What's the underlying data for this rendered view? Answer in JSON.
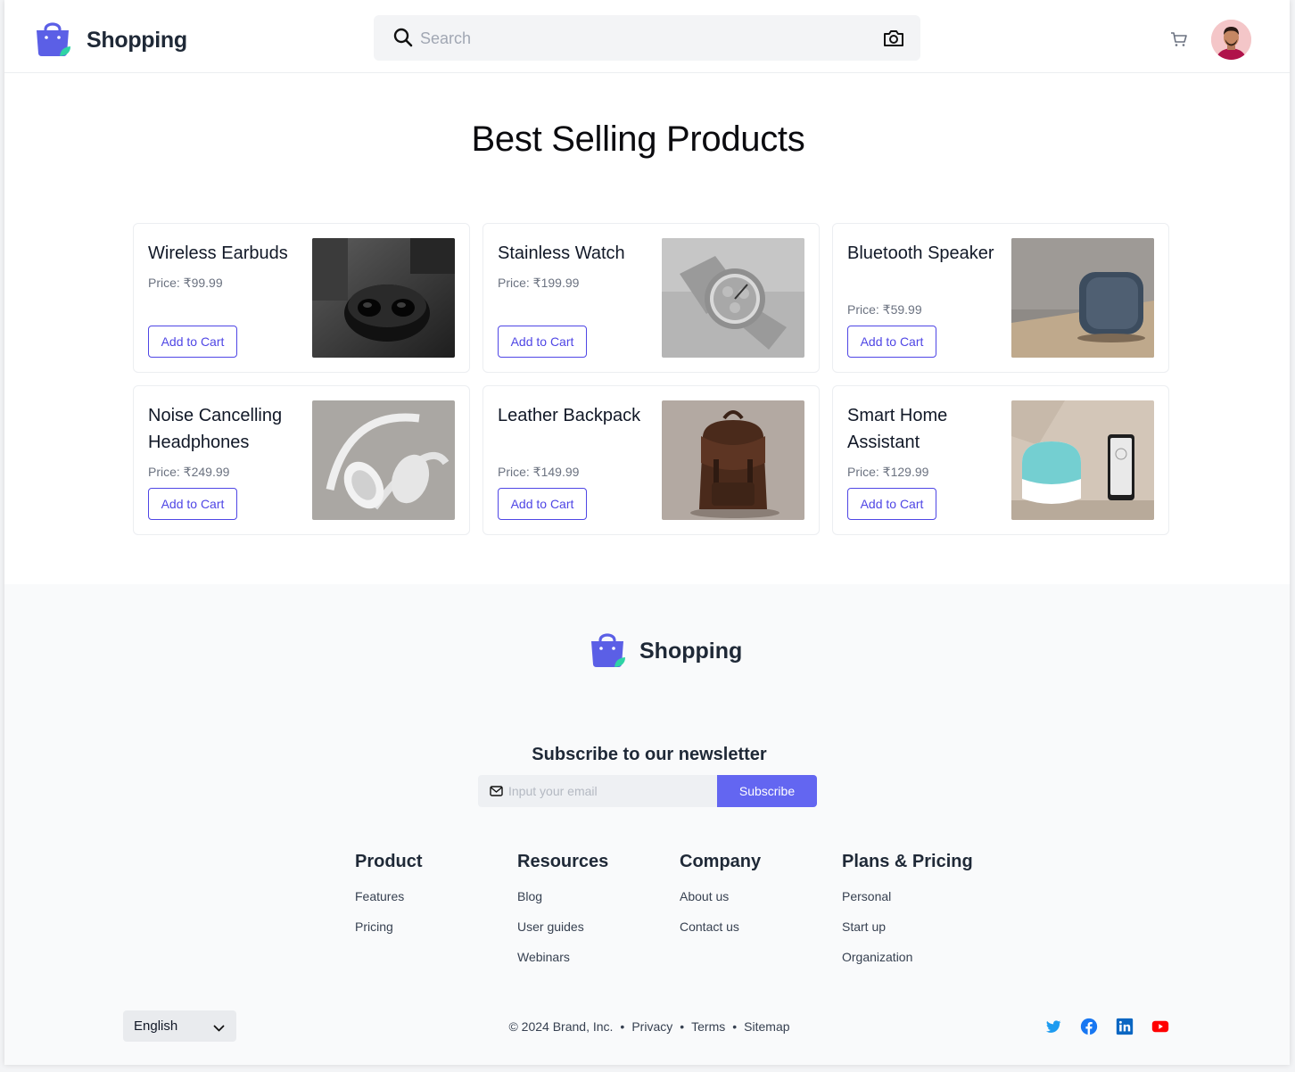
{
  "header": {
    "brand": "Shopping",
    "search_placeholder": "Search"
  },
  "main": {
    "title": "Best Selling Products",
    "products": [
      {
        "name": "Wireless Earbuds",
        "price": "Price: ₹99.99",
        "cta": "Add to Cart",
        "image": "wireless-earbuds-photo"
      },
      {
        "name": "Stainless Watch",
        "price": "Price: ₹199.99",
        "cta": "Add to Cart",
        "image": "stainless-watch-photo"
      },
      {
        "name": "Bluetooth Speaker",
        "price": "Price: ₹59.99",
        "cta": "Add to Cart",
        "image": "bluetooth-speaker-photo"
      },
      {
        "name": "Noise Cancelling Headphones",
        "price": "Price: ₹249.99",
        "cta": "Add to Cart",
        "image": "headphones-photo"
      },
      {
        "name": "Leather Backpack",
        "price": "Price: ₹149.99",
        "cta": "Add to Cart",
        "image": "leather-backpack-photo"
      },
      {
        "name": "Smart Home Assistant",
        "price": "Price: ₹129.99",
        "cta": "Add to Cart",
        "image": "smart-home-assistant-photo"
      }
    ]
  },
  "footer": {
    "brand": "Shopping",
    "newsletter": {
      "title": "Subscribe to our newsletter",
      "placeholder": "Input your email",
      "button": "Subscribe"
    },
    "columns": [
      {
        "title": "Product",
        "links": [
          "Features",
          "Pricing"
        ]
      },
      {
        "title": "Resources",
        "links": [
          "Blog",
          "User guides",
          "Webinars"
        ]
      },
      {
        "title": "Company",
        "links": [
          "About us",
          "Contact us"
        ]
      },
      {
        "title": "Plans & Pricing",
        "links": [
          "Personal",
          "Start up",
          "Organization"
        ]
      }
    ],
    "language": "English",
    "copyright": "© 2024 Brand, Inc.",
    "legal_links": [
      "Privacy",
      "Terms",
      "Sitemap"
    ],
    "social": [
      "twitter-icon",
      "facebook-icon",
      "linkedin-icon",
      "youtube-icon"
    ]
  },
  "colors": {
    "accent": "#6366f1",
    "accent_text": "#4f46e5",
    "twitter": "#1d9bf0",
    "facebook": "#1877f2",
    "linkedin": "#0a66c2",
    "youtube": "#ff0000"
  }
}
